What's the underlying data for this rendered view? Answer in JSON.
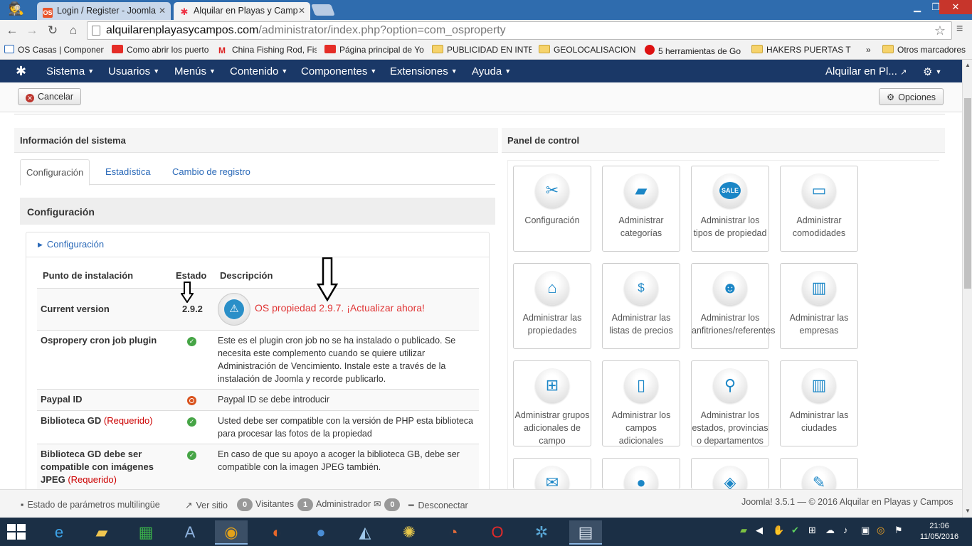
{
  "browser": {
    "tabs": [
      {
        "title": "Login / Register - Joomla",
        "favicon": "OS"
      },
      {
        "title": "Alquilar en Playas y Camp",
        "favicon": "joomla"
      }
    ],
    "url_host": "alquilarenplayasycampos.com",
    "url_path": "/administrator/index.php?option=com_osproperty",
    "bookmarks": [
      "OS Casas | Componen",
      "Como abrir los puerto",
      "China Fishing Rod, Fis",
      "Página principal de Yo",
      "PUBLICIDAD EN INTER",
      "GEOLOCALISACION D",
      "5 herramientas de Go",
      "HAKERS PUERTAS TRA",
      "»",
      "Otros marcadores"
    ]
  },
  "joomla_nav": {
    "menus": [
      "Sistema",
      "Usuarios",
      "Menús",
      "Contenido",
      "Componentes",
      "Extensiones",
      "Ayuda"
    ],
    "site_name": "Alquilar en Pl..."
  },
  "toolbar": {
    "cancel": "Cancelar",
    "options": "Opciones"
  },
  "system_info": {
    "heading": "Información del sistema",
    "tabs": [
      "Configuración",
      "Estadística",
      "Cambio de registro"
    ],
    "section_title": "Configuración",
    "accordion_title": "Configuración",
    "table_headers": {
      "point": "Punto de instalación",
      "status": "Estado",
      "description": "Descripción"
    },
    "current_version_label": "Current version",
    "current_version": "2.9.2",
    "update_notice": "OS propiedad 2.9.7. ¡Actualizar ahora!",
    "rows": [
      {
        "label": "Ospropery cron job plugin",
        "desc": "Este es el plugin cron job no se ha instalado o publicado. Se necesita este complemento cuando se quiere utilizar Administración de Vencimiento. Instale este a través de la instalación de Joomla y recorde publicarlo."
      },
      {
        "label": "Paypal ID",
        "desc": "Paypal ID se debe introducir"
      },
      {
        "label": "Biblioteca GD",
        "required": "(Requerido)",
        "desc": "Usted debe ser compatible con la versión de PHP esta biblioteca para procesar las fotos de la propiedad"
      },
      {
        "label": "Biblioteca GD debe ser compatible con imágenes JPEG",
        "required": "(Requerido)",
        "desc": "En caso de que su apoyo a acoger la biblioteca GB, debe ser compatible con la imagen JPEG también."
      }
    ]
  },
  "control_panel": {
    "heading": "Panel de control",
    "items": [
      {
        "label": "Configuración",
        "icon": "wrench-screwdriver-icon"
      },
      {
        "label": "Administrar categorías",
        "icon": "folder-icon"
      },
      {
        "label": "Administrar los tipos de propiedad",
        "icon": "sale-tag-icon"
      },
      {
        "label": "Administrar comodidades",
        "icon": "monitor-icon"
      },
      {
        "label": "Administrar las propiedades",
        "icon": "house-icon"
      },
      {
        "label": "Administrar las listas de precios",
        "icon": "house-price-icon"
      },
      {
        "label": "Administrar los anfitriones/referentes",
        "icon": "agent-icon"
      },
      {
        "label": "Administrar las empresas",
        "icon": "buildings-icon"
      },
      {
        "label": "Administrar grupos adicionales de campo",
        "icon": "sitemap-icon"
      },
      {
        "label": "Administrar los campos adicionales",
        "icon": "textfield-icon"
      },
      {
        "label": "Administrar los estados, provincias o departamentos",
        "icon": "map-pin-icon"
      },
      {
        "label": "Administrar las ciudades",
        "icon": "city-icon"
      },
      {
        "label": "",
        "icon": "envelope-icon"
      },
      {
        "label": "",
        "icon": "chat-icon"
      },
      {
        "label": "",
        "icon": "tag-icon"
      },
      {
        "label": "",
        "icon": "palette-icon"
      }
    ]
  },
  "statusbar": {
    "multilang": "Estado de parámetros multilingüe",
    "view_site": "Ver sitio",
    "visitors_count": "0",
    "visitors": "Visitantes",
    "admins_count": "1",
    "admins": "Administrador",
    "messages_count": "0",
    "logout": "Desconectar",
    "footer": "Joomla! 3.5.1  —  © 2016 Alquilar en Playas y Campos"
  },
  "taskbar": {
    "time": "21:06",
    "date": "11/05/2016"
  }
}
